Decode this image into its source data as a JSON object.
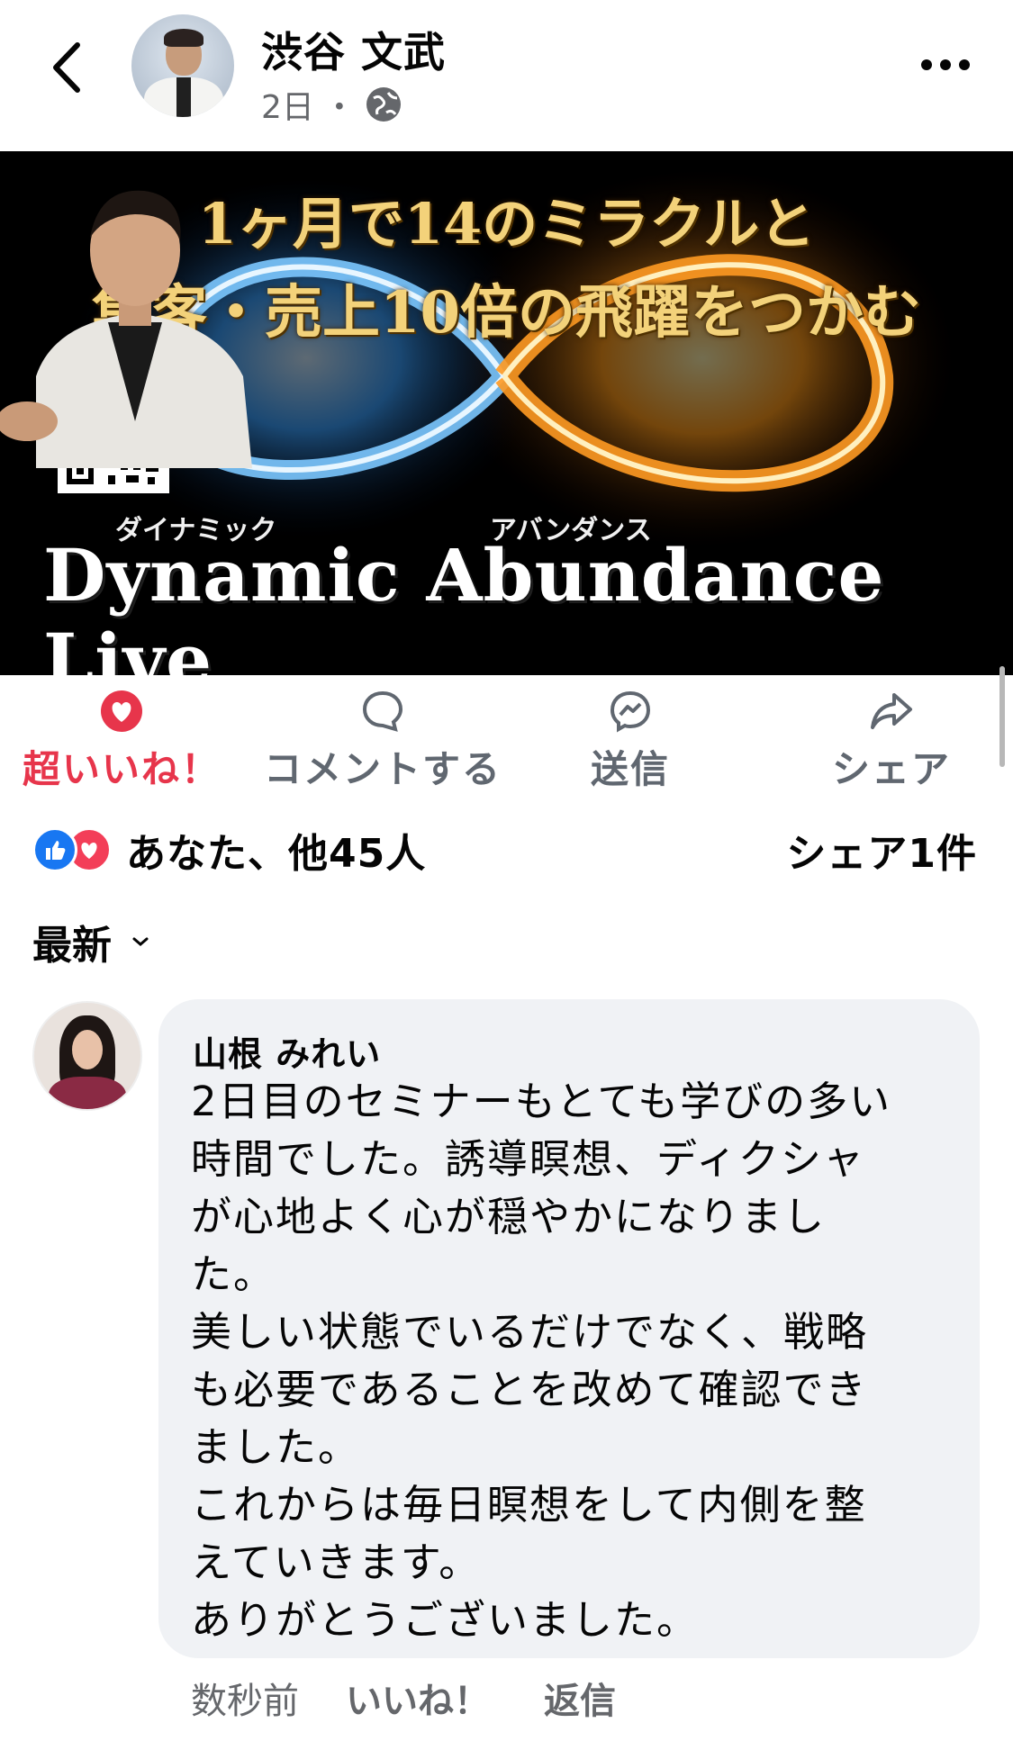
{
  "header": {
    "author": "渋谷 文武",
    "time": "2日",
    "separator": "・",
    "privacy_icon": "globe-icon",
    "back_icon": "chevron-left-icon",
    "more_icon": "more-dots-icon"
  },
  "banner": {
    "line1": "1ヶ月で14のミラクルと",
    "line2": "集客・売上10倍の飛躍をつかむ",
    "ruby_dynamic": "ダイナミック",
    "ruby_abundance": "アバンダンス",
    "title": "Dynamic Abundance Live"
  },
  "actions": {
    "love": "超いいね！",
    "comment": "コメントする",
    "send": "送信",
    "share": "シェア"
  },
  "reactions": {
    "summary": "あなた、他45人",
    "shares": "シェア1件"
  },
  "sort": {
    "label": "最新"
  },
  "comment": {
    "name": "山根 みれい",
    "body": "2日目のセミナーもとても学びの多い\n時間でした。誘導瞑想、ディクシャ\nが心地よく心が穏やかになりまし\nた。\n美しい状態でいるだけでなく、戦略\nも必要であることを改めて確認でき\nました。\nこれからは毎日瞑想をして内側を整\nえていきます。\nありがとうございました。",
    "time": "数秒前",
    "like": "いいね！",
    "reply": "返信"
  },
  "colors": {
    "love_red": "#e7354b",
    "like_blue": "#1877f2",
    "banner_gold": "#f3d27a",
    "bubble_bg": "#f0f2f5"
  }
}
